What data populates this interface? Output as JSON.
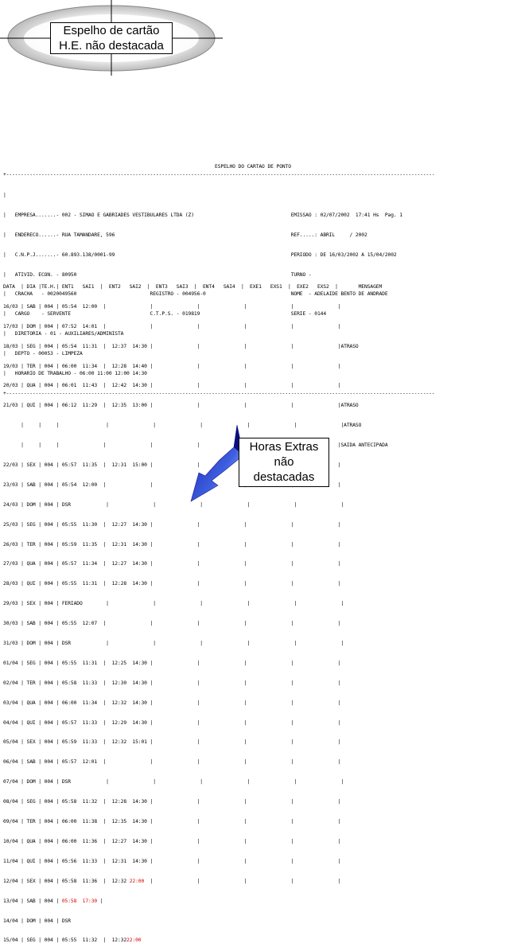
{
  "callout_title": {
    "line1": "Espelho de cartão",
    "line2": "H.E. não destacada"
  },
  "callout_overtime": {
    "line1": "Horas Extras",
    "line2": "não",
    "line3": "destacadas"
  },
  "report_title": "ESPELHO DO CARTAO DE PONTO",
  "dash_line": "+--------------------------------------------------------------------------------------------------------------------------------------------------",
  "header_lines": [
    "|",
    "|   EMPRESA.......- 002 - SIMAO E GABRIADES VESTIBULARES LTDA (Z)                                 EMISSAO : 02/07/2002  17:41 Hs  Pag. 1",
    "|   ENDERECO......- RUA TAMANDARE, 596                                                            REF.....: ABRIL     / 2002",
    "|   C.N.P.J.......- 60.893.138/0001-99                                                            PERIODO : DE 16/03/2002 A 15/04/2002",
    "|   ATIVID. ECON. - 80950                                                                         TURNO -",
    "|   CRACHA   - 0020049560                         REGISTRO - 004956-0                             NOME  - ADELAIDE BENTO DE ANDRADE",
    "|   CARGO    - SERVENTE                           C.T.P.S. - 019819                               SERIE - 0144",
    "|   DIRETORIA - 01 - AUXILIARES/ADMINISTA",
    "|   DEPTO - 00053 - LIMPEZA",
    "|   HORARIO DE TRABALHO - 06:00 11:00 12:00 14:30",
    "+--------------------------------------------------------------------------------------------------------------------------------------------------"
  ],
  "table_header": "DATA  | DIA |TE.H.| ENT1   SAI1  |  ENT2   SAI2  |  ENT3   SAI3  |  ENT4   SAI4  |  EXE1   EXS1  |  EXE2   EXS2  |       MENSAGEM",
  "rows": [
    "16/03 | SAB | 004 | 05:54  12:00  |               |               |               |               |               |",
    "17/03 | DOM | 004 | 07:52  14:01  |               |               |               |               |               |",
    "18/03 | SEG | 004 | 05:54  11:31  |  12:37  14:30 |               |               |               |               |ATRASO",
    "19/03 | TER | 004 | 06:00  11:34  |  12:28  14:40 |               |               |               |               |",
    "20/03 | QUA | 004 | 06:01  11:43  |  12:42  14:30 |               |               |               |               |",
    "21/03 | QUI | 004 | 06:12  11:29  |  12:35  13:00 |               |               |               |               |ATRASO",
    "      |     |     |                |               |               |               |               |               |ATRASO",
    "      |     |     |               |               |               |               |               |               |SAIDA ANTECIPADA",
    "22/03 | SEX | 004 | 05:57  11:35  |  12:31  15:00 |               |               |               |               |",
    "23/03 | SAB | 004 | 05:54  12:00  |               |               |               |               |               |",
    "24/03 | DOM | 004 | DSR            |               |               |               |               |               |",
    "25/03 | SEG | 004 | 05:55  11:30  |  12:27  14:30 |               |               |               |               |",
    "26/03 | TER | 004 | 05:59  11:35  |  12:31  14:30 |               |               |               |               |",
    "27/03 | QUA | 004 | 05:57  11:34  |  12:27  14:30 |               |               |               |               |",
    "28/03 | QUI | 004 | 05:55  11:31  |  12:28  14:30 |               |               |               |               |",
    "29/03 | SEX | 004 | FERIADO        |               |               |               |               |               |",
    "30/03 | SAB | 004 | 05:55  12:07  |               |               |               |               |               |",
    "31/03 | DOM | 004 | DSR            |               |               |               |               |               |",
    "01/04 | SEG | 004 | 05:55  11:31  |  12:25  14:30 |               |               |               |               |",
    "02/04 | TER | 004 | 05:58  11:33  |  12:30  14:30 |               |               |               |               |",
    "03/04 | QUA | 004 | 06:00  11:34  |  12:32  14:30 |               |               |               |               |",
    "04/04 | QUI | 004 | 05:57  11:33  |  12:29  14:30 |               |               |               |               |",
    "05/04 | SEX | 004 | 05:59  11:33  |  12:32  15:01 |               |               |               |               |",
    "06/04 | SAB | 004 | 05:57  12:01  |               |               |               |               |               |",
    "07/04 | DOM | 004 | DSR            |               |               |               |               |               |",
    "08/04 | SEG | 004 | 05:58  11:32  |  12:28  14:30 |               |               |               |               |",
    "09/04 | TER | 004 | 06:00  11:38  |  12:35  14:30 |               |               |               |               |",
    "10/04 | QUA | 004 | 06:00  11:36  |  12:27  14:30 |               |               |               |               |",
    "11/04 | QUI | 004 | 05:56  11:33  |  12:31  14:30 |               |               |               |               |"
  ],
  "row_1204": {
    "prefix": "12/04 | SEX | 004 | 05:58  11:36  |  12:32 ",
    "red": "22:00",
    "suffix": "  |               |               |               |               |"
  },
  "row_1304": {
    "prefix": "13/04 | SAB | 004 | ",
    "red": "05:58  17:30",
    "suffix": " |"
  },
  "row_1404": "14/04 | DOM | 004 | DSR",
  "row_1504": {
    "prefix": "15/04 | SEG | 004 | 05:55  11:32  |  12:32",
    "red": "22:00"
  }
}
